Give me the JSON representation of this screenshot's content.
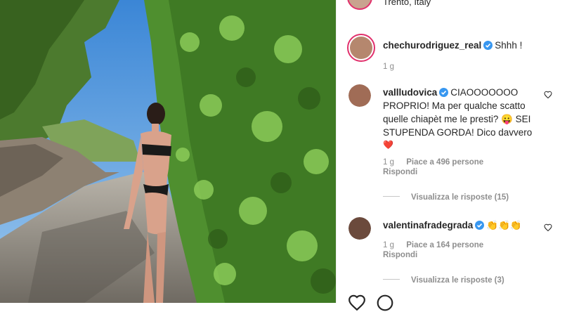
{
  "post": {
    "location": "Trento, Italy",
    "caption": {
      "username": "chechurodriguez_real",
      "text": "Shhh !",
      "time": "1 g"
    },
    "comments": [
      {
        "username": "vallludovica",
        "text": "CIAOOOOOOO PROPRIO! Ma per qualche scatto quelle chiapèt me le presti? 😛 SEI STUPENDA GORDA! Dico davvero",
        "emoji_tail": "❤️",
        "time": "1 g",
        "likes": "Piace a 496 persone",
        "reply": "Rispondi",
        "view_replies": "Visualizza le risposte (15)"
      },
      {
        "username": "valentinafradegrada",
        "text": "👏👏👏",
        "time": "1 g",
        "likes": "Piace a 164 persone",
        "reply": "Rispondi",
        "view_replies": "Visualizza le risposte (3)"
      }
    ]
  },
  "colors": {
    "verified": "#3897f0",
    "story_ring": "#e1306c",
    "heart_red": "#ed4956",
    "muted": "#8e8e8e"
  },
  "icons": [
    "verified-badge-icon",
    "heart-outline-icon",
    "like-icon",
    "comment-icon"
  ]
}
